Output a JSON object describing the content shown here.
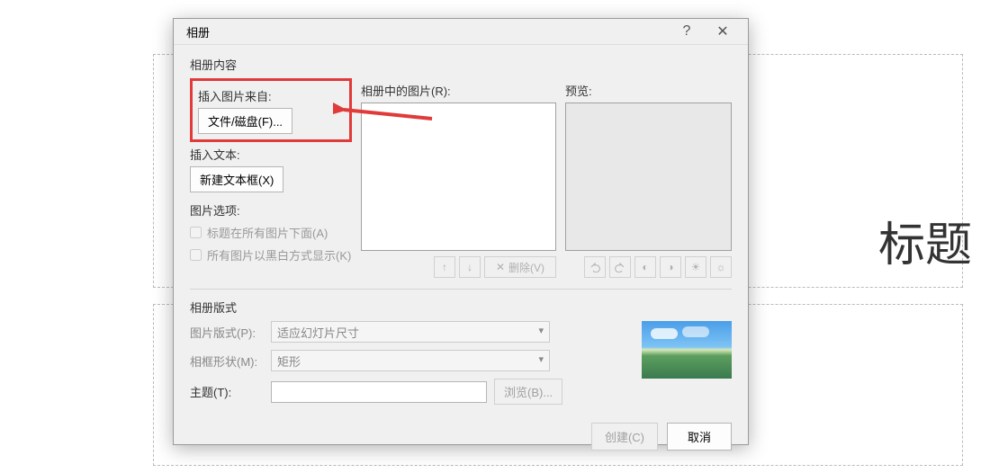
{
  "background": {
    "slide_title": "标题"
  },
  "dialog": {
    "title": "相册",
    "help": "?",
    "close": "✕"
  },
  "content": {
    "section_label": "相册内容",
    "insert_from_label": "插入图片来自:",
    "file_disk_btn": "文件/磁盘(F)...",
    "insert_text_label": "插入文本:",
    "new_textbox_btn": "新建文本框(X)",
    "options_label": "图片选项:",
    "caption_below_label": "标题在所有图片下面(A)",
    "bw_display_label": "所有图片以黑白方式显示(K)"
  },
  "middle": {
    "list_label": "相册中的图片(R):",
    "remove_btn": "删除(V)"
  },
  "preview": {
    "label": "预览:"
  },
  "format": {
    "section_label": "相册版式",
    "layout_label": "图片版式(P):",
    "layout_value": "适应幻灯片尺寸",
    "frame_label": "相框形状(M):",
    "frame_value": "矩形",
    "theme_label": "主题(T):",
    "browse_btn": "浏览(B)..."
  },
  "footer": {
    "create_btn": "创建(C)",
    "cancel_btn": "取消"
  }
}
